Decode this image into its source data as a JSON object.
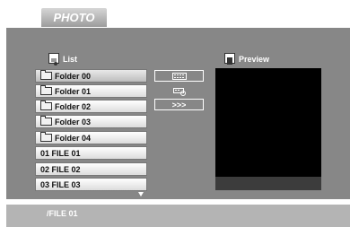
{
  "tab": {
    "label": "PHOTO"
  },
  "list": {
    "title": "List",
    "items": [
      {
        "label": "Folder 00",
        "type": "folder",
        "selected": true
      },
      {
        "label": "Folder 01",
        "type": "folder"
      },
      {
        "label": "Folder 02",
        "type": "folder"
      },
      {
        "label": "Folder 03",
        "type": "folder"
      },
      {
        "label": "Folder 04",
        "type": "folder"
      },
      {
        "label": "01 FILE 01",
        "type": "file"
      },
      {
        "label": "02 FILE 02",
        "type": "file"
      },
      {
        "label": "03 FILE 03",
        "type": "file"
      }
    ],
    "scroll_icon": "arrow-down-icon"
  },
  "controls": {
    "next_label": ">>>",
    "icons": [
      "slideshow-icon",
      "slideshow-settings-icon"
    ]
  },
  "preview": {
    "title": "Preview"
  },
  "status": {
    "path": "/FILE 01"
  },
  "colors": {
    "panel": "#878787",
    "bottombar": "#b4b4b4",
    "preview": "#000000"
  }
}
